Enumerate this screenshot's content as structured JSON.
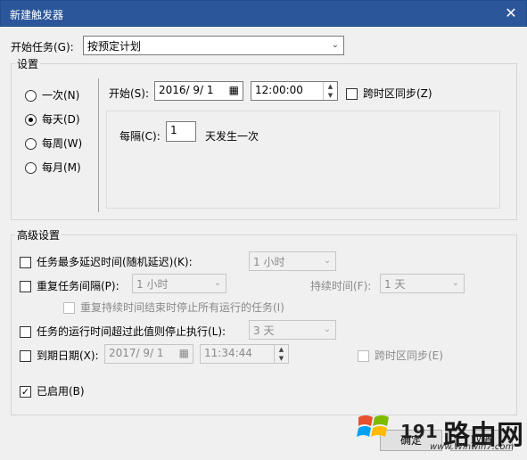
{
  "window": {
    "title": "新建触发器",
    "close_glyph": "✕"
  },
  "start_task": {
    "label": "开始任务(G):",
    "value": "按预定计划"
  },
  "settings": {
    "legend": "设置",
    "radios": [
      {
        "label": "一次(N)",
        "checked": false
      },
      {
        "label": "每天(D)",
        "checked": true
      },
      {
        "label": "每周(W)",
        "checked": false
      },
      {
        "label": "每月(M)",
        "checked": false
      }
    ],
    "start_label": "开始(S):",
    "start_date": "2016/ 9/ 1",
    "start_time": "12:00:00",
    "sync_timezone": "跨时区同步(Z)",
    "every_label": "每隔(C):",
    "every_value": "1",
    "every_unit": "天发生一次"
  },
  "advanced": {
    "legend": "高级设置",
    "delay_label": "任务最多延迟时间(随机延迟)(K):",
    "delay_value": "1 小时",
    "repeat_label": "重复任务间隔(P):",
    "repeat_value": "1 小时",
    "duration_label": "持续时间(F):",
    "duration_value": "1 天",
    "stop_all_label": "重复持续时间结束时停止所有运行的任务(I)",
    "stop_longer_label": "任务的运行时间超过此值则停止执行(L):",
    "stop_longer_value": "3 天",
    "expire_label": "到期日期(X):",
    "expire_date": "2017/ 9/ 1",
    "expire_time": "11:34:44",
    "expire_sync": "跨时区同步(E)",
    "enabled_label": "已启用(B)"
  },
  "buttons": {
    "ok": "确定",
    "cancel": "取消"
  },
  "watermark": {
    "text": "路由网",
    "sub": "www.Winwin7.com",
    "num": "191"
  }
}
